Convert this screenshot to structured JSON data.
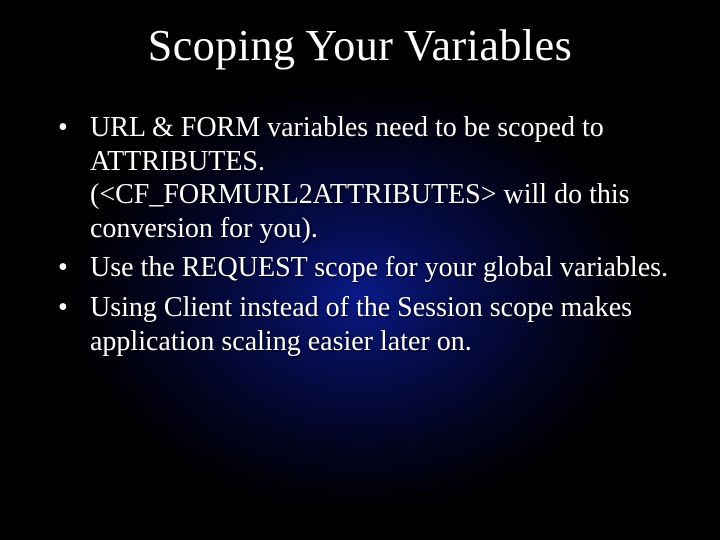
{
  "slide": {
    "title": "Scoping Your Variables",
    "bullets": [
      "URL & FORM variables need to be scoped to ATTRIBUTES. (<CF_FORMURL2ATTRIBUTES> will do this conversion for you).",
      "Use the REQUEST scope for your global variables.",
      "Using Client instead of the Session scope makes application scaling easier later on."
    ]
  }
}
